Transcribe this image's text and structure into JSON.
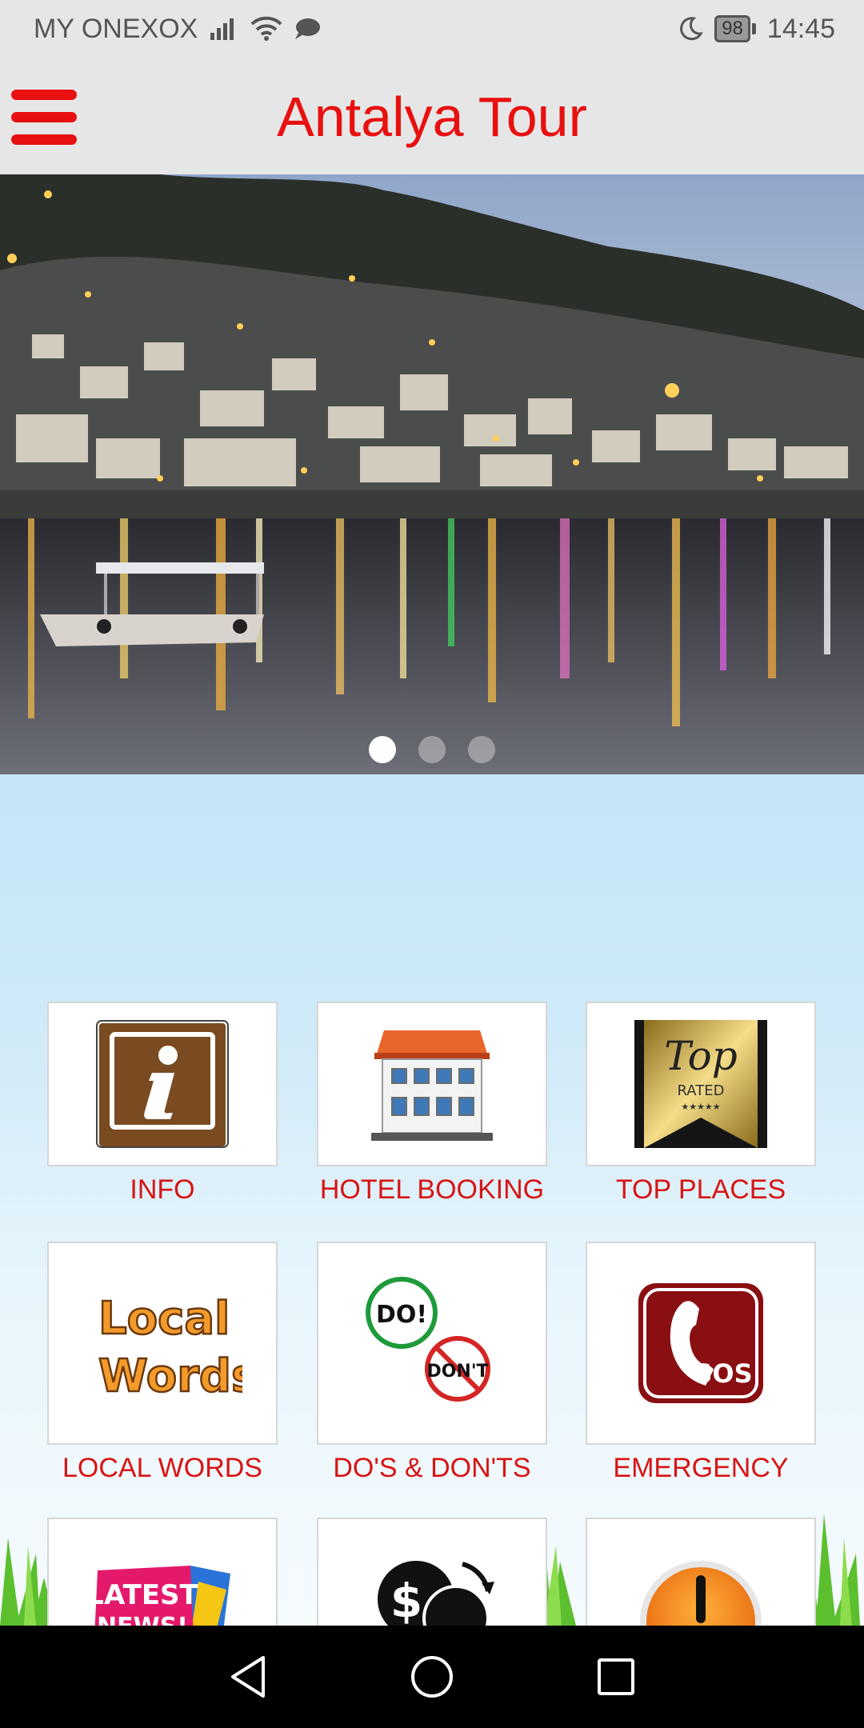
{
  "status_bar": {
    "carrier": "MY ONEXOX",
    "battery": "98",
    "time": "14:45"
  },
  "app_bar": {
    "title": "Antalya Tour"
  },
  "carousel": {
    "slides": 3,
    "active": 0
  },
  "tiles": [
    {
      "label": "INFO",
      "icon": "info-icon"
    },
    {
      "label": "HOTEL BOOKING",
      "icon": "hotel-icon"
    },
    {
      "label": "TOP PLACES",
      "icon": "top-rated-icon",
      "badge_top": "Top",
      "badge_sub": "RATED",
      "badge_stars": "★★★★★"
    },
    {
      "label": "LOCAL WORDS",
      "icon": "local-words-icon",
      "line1": "Local",
      "line2": "Words"
    },
    {
      "label": "DO'S & DON'TS",
      "icon": "dos-donts-icon",
      "do": "DO!",
      "dont": "DON'T"
    },
    {
      "label": "EMERGENCY",
      "icon": "sos-icon",
      "sos": "SOS"
    },
    {
      "label": "",
      "icon": "latest-news-icon",
      "text": "LATEST",
      "text2": "NEWS!"
    },
    {
      "label": "",
      "icon": "currency-icon"
    },
    {
      "label": "",
      "icon": "warning-icon"
    }
  ],
  "colors": {
    "accent": "#e81010",
    "label": "#d81414",
    "bar": "#e6e6e6"
  }
}
